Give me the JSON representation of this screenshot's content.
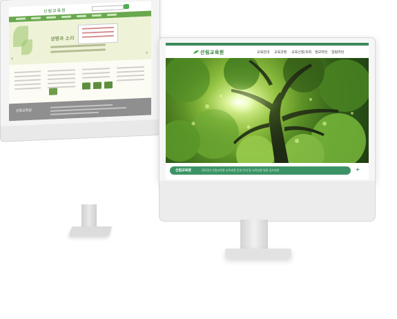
{
  "back_site": {
    "logo_text": "산림교육원",
    "hero_title": "생명과 소리",
    "footer_logo": "산림교육원"
  },
  "front_site": {
    "logo_text": "산림교육원",
    "menu": [
      "교육안내",
      "교육과정",
      "교육신청/조회",
      "정보마당",
      "알림마당"
    ],
    "notice_label": "산림교육원",
    "notice_text": "2023년 산림교육원 교육과정 운영 안내 및 교육신청 일정 공지사항",
    "notice_more": "+"
  },
  "colors": {
    "brand_green": "#3c9466",
    "nav_green": "#6aa84f",
    "footer_gray": "#8f8f8f"
  }
}
